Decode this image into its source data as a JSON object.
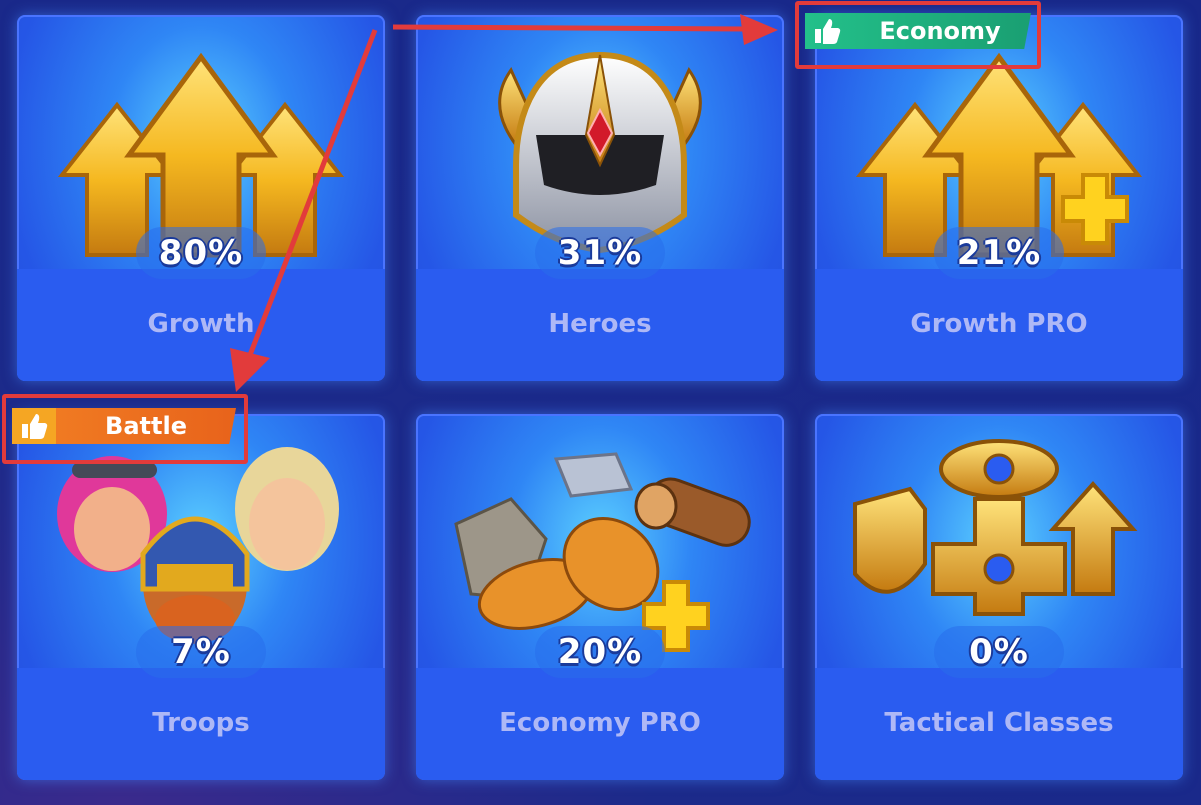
{
  "cards": [
    {
      "percent": "80%",
      "label": "Growth"
    },
    {
      "percent": "31%",
      "label": "Heroes"
    },
    {
      "percent": "21%",
      "label": "Growth PRO"
    },
    {
      "percent": "7%",
      "label": "Troops"
    },
    {
      "percent": "20%",
      "label": "Economy PRO"
    },
    {
      "percent": "0%",
      "label": "Tactical Classes"
    }
  ],
  "tags": {
    "economy": {
      "label": "Economy",
      "color": "#1fae7c",
      "icon": "thumbs-up-icon"
    },
    "battle": {
      "label": "Battle",
      "color": "#f07a22",
      "icon": "thumbs-up-icon"
    }
  },
  "colors": {
    "annotation": "#e23b3b",
    "card_blue": "#2a5cf0",
    "gold": "#f5c124"
  }
}
